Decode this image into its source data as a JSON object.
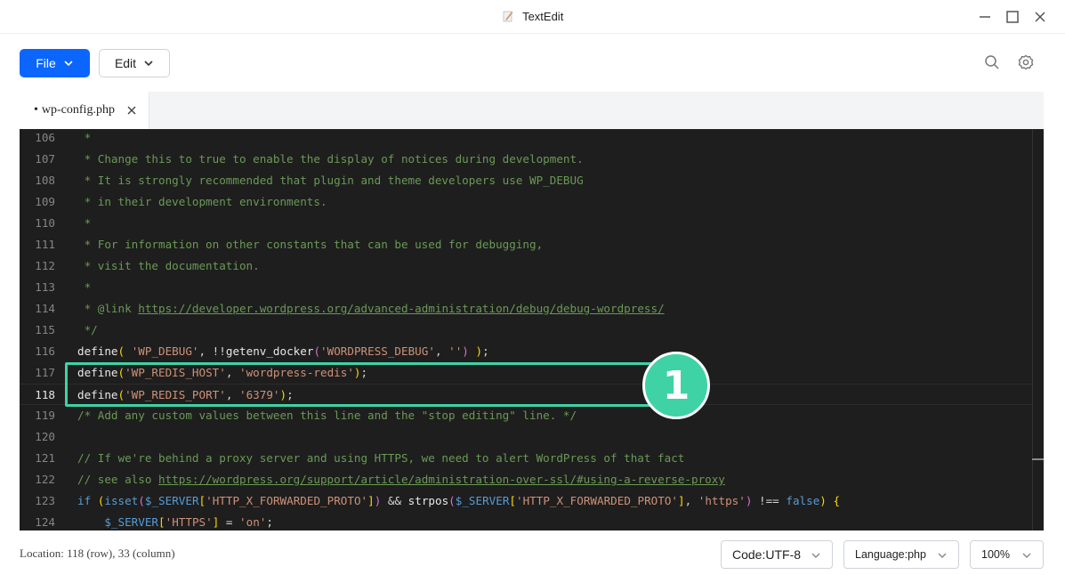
{
  "window": {
    "title": "TextEdit",
    "icon": "pencil-note-icon"
  },
  "toolbar": {
    "file_label": "File",
    "edit_label": "Edit"
  },
  "tabs": [
    {
      "label": "wp-config.php",
      "modified_marker": "•"
    }
  ],
  "editor": {
    "lines": [
      {
        "num": "106",
        "tokens": [
          {
            "t": " *",
            "c": "cm"
          }
        ]
      },
      {
        "num": "107",
        "tokens": [
          {
            "t": " * Change this to true to enable the display of notices during development.",
            "c": "cm"
          }
        ]
      },
      {
        "num": "108",
        "tokens": [
          {
            "t": " * It is strongly recommended that plugin and theme developers use WP_DEBUG",
            "c": "cm"
          }
        ]
      },
      {
        "num": "109",
        "tokens": [
          {
            "t": " * in their development environments.",
            "c": "cm"
          }
        ]
      },
      {
        "num": "110",
        "tokens": [
          {
            "t": " *",
            "c": "cm"
          }
        ]
      },
      {
        "num": "111",
        "tokens": [
          {
            "t": " * For information on other constants that can be used for debugging,",
            "c": "cm"
          }
        ]
      },
      {
        "num": "112",
        "tokens": [
          {
            "t": " * visit the documentation.",
            "c": "cm"
          }
        ]
      },
      {
        "num": "113",
        "tokens": [
          {
            "t": " *",
            "c": "cm"
          }
        ]
      },
      {
        "num": "114",
        "tokens": [
          {
            "t": " * @link ",
            "c": "cm"
          },
          {
            "t": "https://developer.wordpress.org/advanced-administration/debug/debug-wordpress/",
            "c": "link"
          }
        ]
      },
      {
        "num": "115",
        "tokens": [
          {
            "t": " */",
            "c": "cm"
          }
        ]
      },
      {
        "num": "116",
        "tokens": [
          {
            "t": "define",
            "c": "df"
          },
          {
            "t": "(",
            "c": "br1"
          },
          {
            "t": " ",
            "c": "pl"
          },
          {
            "t": "'WP_DEBUG'",
            "c": "str"
          },
          {
            "t": ", !!",
            "c": "pl"
          },
          {
            "t": "getenv_docker",
            "c": "df"
          },
          {
            "t": "(",
            "c": "br2"
          },
          {
            "t": "'WORDPRESS_DEBUG'",
            "c": "str"
          },
          {
            "t": ", ",
            "c": "pl"
          },
          {
            "t": "''",
            "c": "str"
          },
          {
            "t": ")",
            "c": "br2"
          },
          {
            "t": " ",
            "c": "pl"
          },
          {
            "t": ")",
            "c": "br1"
          },
          {
            "t": ";",
            "c": "pl"
          }
        ]
      },
      {
        "num": "117",
        "tokens": [
          {
            "t": "define",
            "c": "df"
          },
          {
            "t": "(",
            "c": "br1"
          },
          {
            "t": "'WP_REDIS_HOST'",
            "c": "str"
          },
          {
            "t": ", ",
            "c": "pl"
          },
          {
            "t": "'wordpress-redis'",
            "c": "str"
          },
          {
            "t": ")",
            "c": "br1"
          },
          {
            "t": ";",
            "c": "pl"
          }
        ]
      },
      {
        "num": "118",
        "tokens": [
          {
            "t": "define",
            "c": "df"
          },
          {
            "t": "(",
            "c": "br1"
          },
          {
            "t": "'WP_REDIS_PORT'",
            "c": "str"
          },
          {
            "t": ", ",
            "c": "pl"
          },
          {
            "t": "'6379'",
            "c": "str"
          },
          {
            "t": ")",
            "c": "br1"
          },
          {
            "t": ";",
            "c": "pl"
          }
        ],
        "active": true
      },
      {
        "num": "119",
        "tokens": [
          {
            "t": "/* Add any custom values between this line and the \"stop editing\" line. */",
            "c": "cm"
          }
        ]
      },
      {
        "num": "120",
        "tokens": []
      },
      {
        "num": "121",
        "tokens": [
          {
            "t": "// If we're behind a proxy server and using HTTPS, we need to alert WordPress of that fact",
            "c": "cm"
          }
        ]
      },
      {
        "num": "122",
        "tokens": [
          {
            "t": "// see also ",
            "c": "cm"
          },
          {
            "t": "https://wordpress.org/support/article/administration-over-ssl/#using-a-reverse-proxy",
            "c": "link"
          }
        ]
      },
      {
        "num": "123",
        "tokens": [
          {
            "t": "if",
            "c": "kw"
          },
          {
            "t": " ",
            "c": "pl"
          },
          {
            "t": "(",
            "c": "br1"
          },
          {
            "t": "isset",
            "c": "kw"
          },
          {
            "t": "(",
            "c": "br2"
          },
          {
            "t": "$_SERVER",
            "c": "var"
          },
          {
            "t": "[",
            "c": "br1"
          },
          {
            "t": "'HTTP_X_FORWARDED_PROTO'",
            "c": "str"
          },
          {
            "t": "]",
            "c": "br1"
          },
          {
            "t": ")",
            "c": "br2"
          },
          {
            "t": " && ",
            "c": "pl"
          },
          {
            "t": "strpos",
            "c": "df"
          },
          {
            "t": "(",
            "c": "br2"
          },
          {
            "t": "$_SERVER",
            "c": "var"
          },
          {
            "t": "[",
            "c": "br1"
          },
          {
            "t": "'HTTP_X_FORWARDED_PROTO'",
            "c": "str"
          },
          {
            "t": "]",
            "c": "br1"
          },
          {
            "t": ", ",
            "c": "pl"
          },
          {
            "t": "'https'",
            "c": "str"
          },
          {
            "t": ")",
            "c": "br2"
          },
          {
            "t": " !== ",
            "c": "pl"
          },
          {
            "t": "false",
            "c": "kw"
          },
          {
            "t": ")",
            "c": "br1"
          },
          {
            "t": " ",
            "c": "pl"
          },
          {
            "t": "{",
            "c": "br1"
          }
        ]
      },
      {
        "num": "124",
        "tokens": [
          {
            "t": "    ",
            "c": "pl"
          },
          {
            "t": "$_SERVER",
            "c": "var"
          },
          {
            "t": "[",
            "c": "br1"
          },
          {
            "t": "'HTTPS'",
            "c": "str"
          },
          {
            "t": "]",
            "c": "br1"
          },
          {
            "t": " = ",
            "c": "pl"
          },
          {
            "t": "'on'",
            "c": "str"
          },
          {
            "t": ";",
            "c": "pl"
          }
        ]
      }
    ]
  },
  "annotation": {
    "badge": "1",
    "color": "#3fd2a5"
  },
  "status": {
    "location": "Location: 118 (row), 33 (column)",
    "encoding": "Code:UTF-8",
    "language": "Language:php",
    "zoom": "100%"
  },
  "colors": {
    "accent": "#0a66ff",
    "editor_bg": "#1e1e1e",
    "comment": "#6a9955",
    "string": "#ce9178"
  }
}
